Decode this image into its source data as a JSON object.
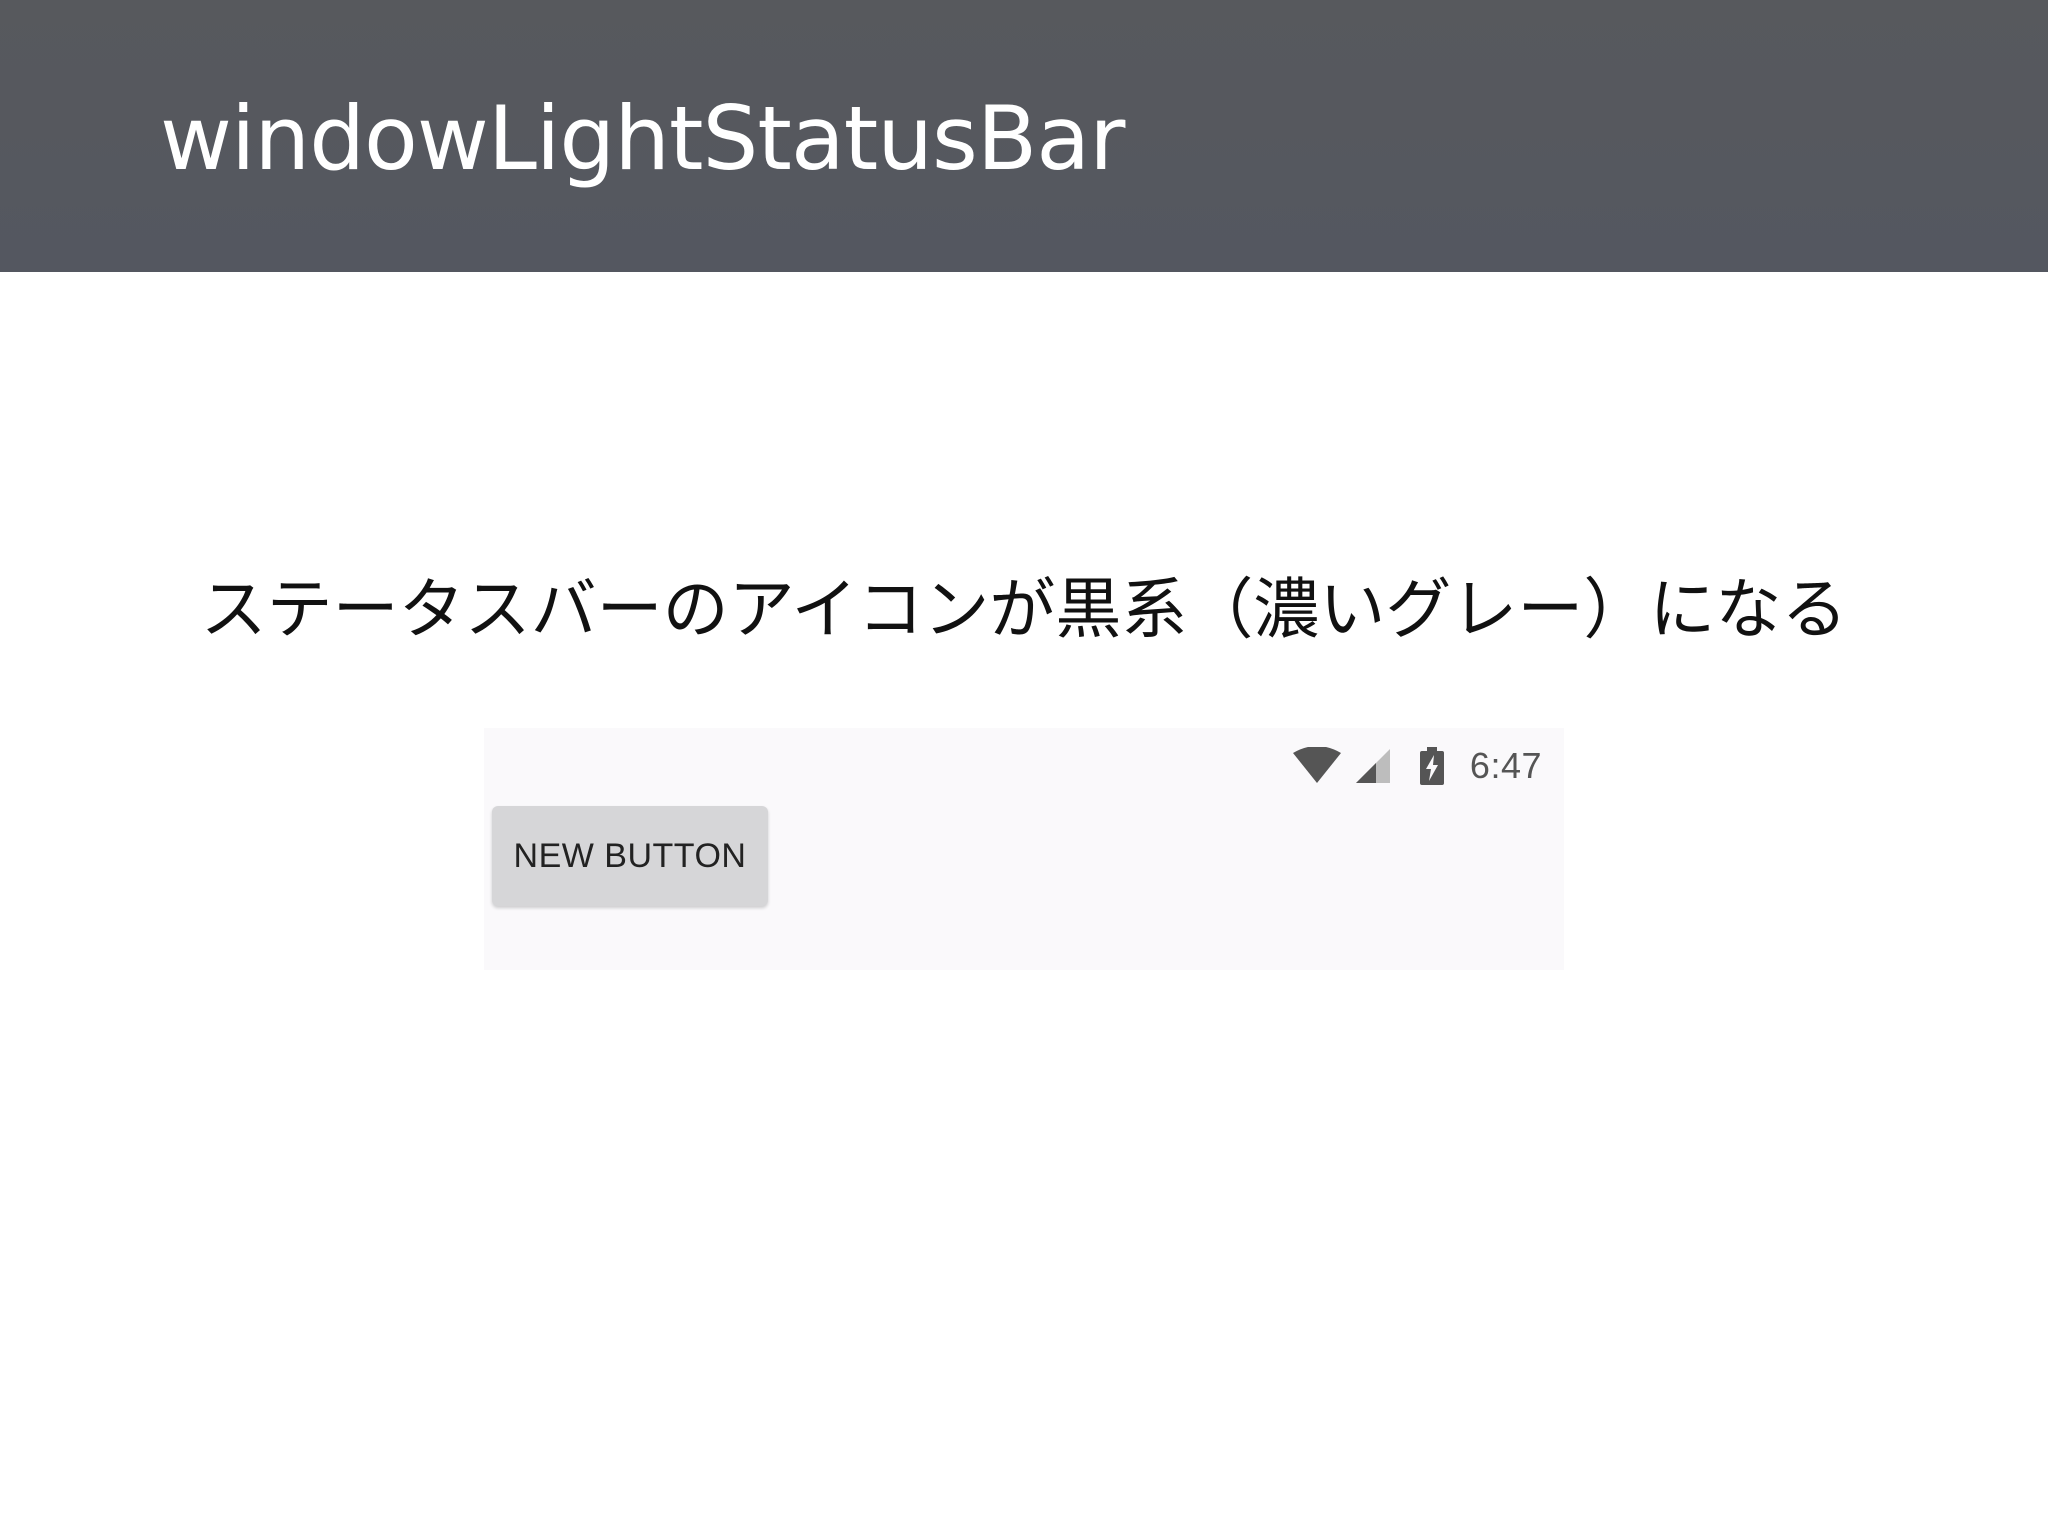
{
  "slide": {
    "title": "windowLightStatusBar",
    "caption": "ステータスバーのアイコンが黒系（濃いグレー）になる"
  },
  "screenshot": {
    "status_bar": {
      "icons": [
        "wifi-icon",
        "cellular-signal-icon",
        "battery-charging-icon"
      ],
      "time": "6:47",
      "icon_color": "#555555"
    },
    "button": {
      "label": "NEW BUTTON"
    },
    "background_color": "#faf9fb"
  },
  "colors": {
    "header_background": "#56585f",
    "title_text": "#ffffff",
    "caption_text": "#111111"
  }
}
